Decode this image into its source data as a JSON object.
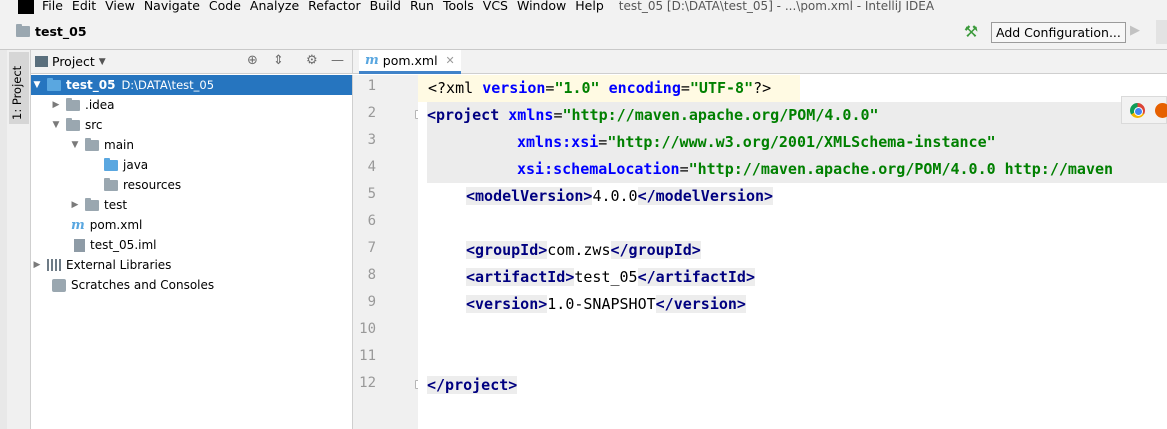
{
  "menu": {
    "items": [
      "File",
      "Edit",
      "View",
      "Navigate",
      "Code",
      "Analyze",
      "Refactor",
      "Build",
      "Run",
      "Tools",
      "VCS",
      "Window",
      "Help"
    ],
    "window_title": "test_05 [D:\\DATA\\test_05] - ...\\pom.xml - IntelliJ IDEA"
  },
  "navbar": {
    "project_name": "test_05",
    "add_configuration": "Add Configuration..."
  },
  "tool_stripe": {
    "project_tab": "1: Project"
  },
  "project_panel": {
    "title": "Project",
    "tree": [
      {
        "label": "test_05",
        "path": "D:\\DATA\\test_05",
        "expanded": true,
        "selected": true,
        "icon": "module-folder-icon"
      },
      {
        "label": ".idea",
        "expanded": false,
        "icon": "folder-icon"
      },
      {
        "label": "src",
        "expanded": true,
        "icon": "folder-icon"
      },
      {
        "label": "main",
        "expanded": true,
        "icon": "folder-icon"
      },
      {
        "label": "java",
        "icon": "source-folder-icon"
      },
      {
        "label": "resources",
        "icon": "resources-folder-icon"
      },
      {
        "label": "test",
        "expanded": false,
        "icon": "folder-icon"
      },
      {
        "label": "pom.xml",
        "icon": "maven-file-icon"
      },
      {
        "label": "test_05.iml",
        "icon": "iml-file-icon"
      },
      {
        "label": "External Libraries",
        "expanded": false,
        "icon": "libraries-icon"
      },
      {
        "label": "Scratches and Consoles",
        "icon": "scratches-icon"
      }
    ]
  },
  "editor": {
    "tab_label": "pom.xml",
    "line_numbers": [
      "1",
      "2",
      "3",
      "4",
      "5",
      "6",
      "7",
      "8",
      "9",
      "10",
      "11",
      "12"
    ],
    "lines": {
      "l1_pi": "<?xml ",
      "l1_attr1": "version",
      "l1_eq1": "=",
      "l1_val1": "\"1.0\"",
      "l1_attr2": " encoding",
      "l1_eq2": "=",
      "l1_val2": "\"UTF-8\"",
      "l1_end": "?>",
      "l2_open": "<project ",
      "l2_attr": "xmlns",
      "l2_eq": "=",
      "l2_val": "\"http://maven.apache.org/POM/4.0.0\"",
      "l3_attr": "xmlns:xsi",
      "l3_eq": "=",
      "l3_val": "\"http://www.w3.org/2001/XMLSchema-instance\"",
      "l4_attr": "xsi:schemaLocation",
      "l4_eq": "=",
      "l4_val": "\"http://maven.apache.org/POM/4.0.0 http://maven",
      "l5_open": "<modelVersion>",
      "l5_text": "4.0.0",
      "l5_close": "</modelVersion>",
      "l7_open": "<groupId>",
      "l7_text": "com.zws",
      "l7_close": "</groupId>",
      "l8_open": "<artifactId>",
      "l8_text": "test_05",
      "l8_close": "</artifactId>",
      "l9_open": "<version>",
      "l9_text": "1.0-SNAPSHOT",
      "l9_close": "</version>",
      "l12_close": "</project>"
    }
  }
}
